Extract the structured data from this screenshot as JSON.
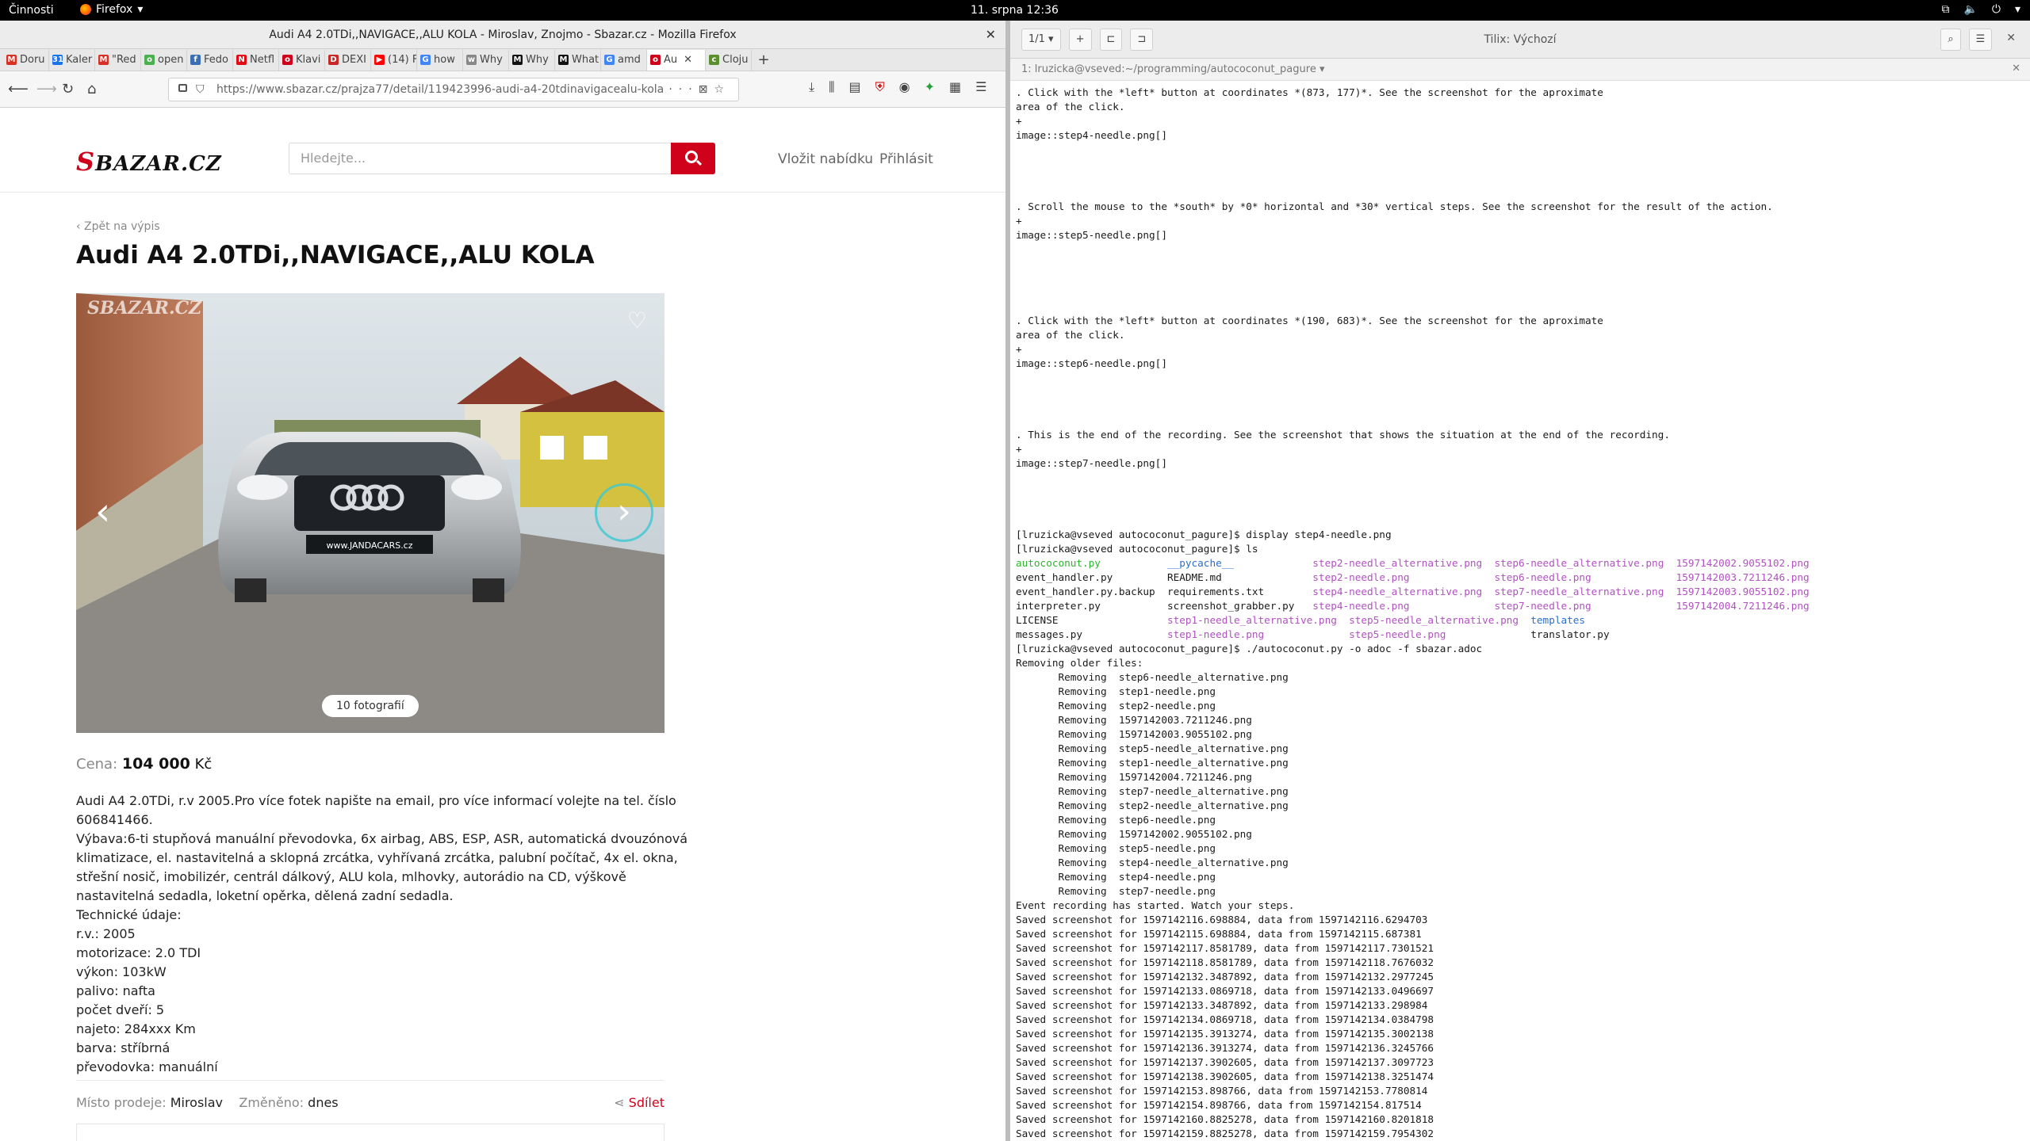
{
  "desktop": {
    "activities": "Činnosti",
    "app_name": "Firefox",
    "clock": "11. srpna  12:36"
  },
  "firefox": {
    "window_title": "Audi A4 2.0TDi,,NAVIGACE,,ALU KOLA - Miroslav, Znojmo - Sbazar.cz - Mozilla Firefox",
    "tabs": [
      {
        "label": "Doru",
        "color": "#d93025",
        "glyph": "M"
      },
      {
        "label": "Kaler",
        "color": "#1a73e8",
        "glyph": "31"
      },
      {
        "label": "\"Red",
        "color": "#d93025",
        "glyph": "M"
      },
      {
        "label": "open",
        "color": "#4caf50",
        "glyph": "o"
      },
      {
        "label": "Fedo",
        "color": "#3c6eb4",
        "glyph": "f"
      },
      {
        "label": "Netfl",
        "color": "#e50914",
        "glyph": "N"
      },
      {
        "label": "Klavi",
        "color": "#d0021b",
        "glyph": "o"
      },
      {
        "label": "DEXI",
        "color": "#c62828",
        "glyph": "D"
      },
      {
        "label": "(14) F",
        "color": "#ff0000",
        "glyph": "▶"
      },
      {
        "label": "how",
        "color": "#4285f4",
        "glyph": "G"
      },
      {
        "label": "Why",
        "color": "#888888",
        "glyph": "w"
      },
      {
        "label": "Why",
        "color": "#111111",
        "glyph": "M"
      },
      {
        "label": "What",
        "color": "#111111",
        "glyph": "M"
      },
      {
        "label": "amd",
        "color": "#4285f4",
        "glyph": "G"
      },
      {
        "label": "Au",
        "color": "#d0021b",
        "glyph": "o"
      },
      {
        "label": "Cloju",
        "color": "#5b8f2e",
        "glyph": "c"
      }
    ],
    "url": "https://www.sbazar.cz/prajza77/detail/119423996-audi-a4-20tdinavigacealu-kola"
  },
  "sbazar": {
    "logo": "SBAZAR.CZ",
    "search_placeholder": "Hledejte...",
    "offer_link": "Vložit nabídku",
    "login_link": "Přihlásit",
    "back_link": "‹ Zpět na výpis",
    "title": "Audi A4 2.0TDi,,NAVIGACE,,ALU KOLA",
    "watermark": "SBAZAR.CZ",
    "photo_count": "10 fotografií",
    "plate": "www.JANDACARS.cz",
    "price_label": "Cena:",
    "price_value": "104 000",
    "price_currency": "Kč",
    "description": [
      "Audi A4 2.0TDi, r.v 2005.Pro více fotek napište na email, pro více informací volejte na tel. číslo",
      "606841466.",
      "Výbava:6-ti stupňová manuální převodovka, 6x airbag, ABS, ESP, ASR, automatická dvouzónová",
      "klimatizace, el. nastavitelná a sklopná zrcátka, vyhřívaná zrcátka, palubní počítač, 4x el. okna,",
      "střešní nosič, imobilizér, centrál dálkový, ALU kola, mlhovky, autorádio na CD, výškově",
      "nastavitelná sedadla, loketní opěrka, dělená zadní sedadla.",
      "Technické údaje:",
      "r.v.: 2005",
      "motorizace: 2.0 TDI",
      "výkon: 103kW",
      "palivo: nafta",
      "počet dveří: 5",
      "najeto: 284xxx Km",
      "barva: stříbrná",
      "převodovka: manuální"
    ],
    "place_label": "Místo prodeje:",
    "place_value": "Miroslav",
    "changed_label": "Změněno:",
    "changed_value": "dnes",
    "share": "Sdílet"
  },
  "tilix": {
    "title": "Tilix: Výchozí",
    "session": "1/1",
    "tab_label": "1: lruzicka@vseved:~/programming/autococonut_pagure"
  },
  "terminal": [
    [
      [
        ". Click with the *left* button at coordinates *(873, 177)*. See the screenshot for the aproximate",
        ""
      ]
    ],
    [
      [
        "area of the click.",
        ""
      ]
    ],
    [
      [
        "+",
        ""
      ]
    ],
    [
      [
        "image::step4-needle.png[]",
        ""
      ]
    ],
    [],
    [],
    [],
    [],
    [
      [
        ". Scroll the mouse to the *south* by *0* horizontal and *30* vertical steps. See the screenshot for the result of the action.",
        ""
      ]
    ],
    [
      [
        "+",
        ""
      ]
    ],
    [
      [
        "image::step5-needle.png[]",
        ""
      ]
    ],
    [],
    [],
    [],
    [],
    [],
    [
      [
        ". Click with the *left* button at coordinates *(190, 683)*. See the screenshot for the aproximate",
        ""
      ]
    ],
    [
      [
        "area of the click.",
        ""
      ]
    ],
    [
      [
        "+",
        ""
      ]
    ],
    [
      [
        "image::step6-needle.png[]",
        ""
      ]
    ],
    [],
    [],
    [],
    [],
    [
      [
        ". This is the end of the recording. See the screenshot that shows the situation at the end of the recording.",
        ""
      ]
    ],
    [
      [
        "+",
        ""
      ]
    ],
    [
      [
        "image::step7-needle.png[]",
        ""
      ]
    ],
    [],
    [],
    [],
    [],
    [
      [
        "[lruzicka@vseved autococonut_pagure]$ display step4-needle.png",
        ""
      ]
    ],
    [
      [
        "[lruzicka@vseved autococonut_pagure]$ ls",
        ""
      ]
    ],
    [
      [
        "autococonut.py           ",
        "c-green"
      ],
      [
        "__pycache__             ",
        "c-blue"
      ],
      [
        "step2-needle_alternative.png  ",
        "c-mag"
      ],
      [
        "step6-needle_alternative.png  ",
        "c-mag"
      ],
      [
        "1597142002.9055102.png",
        "c-mag"
      ]
    ],
    [
      [
        "event_handler.py         ",
        ""
      ],
      [
        "README.md               ",
        ""
      ],
      [
        "step2-needle.png              ",
        "c-mag"
      ],
      [
        "step6-needle.png              ",
        "c-mag"
      ],
      [
        "1597142003.7211246.png",
        "c-mag"
      ]
    ],
    [
      [
        "event_handler.py.backup  ",
        ""
      ],
      [
        "requirements.txt        ",
        ""
      ],
      [
        "step4-needle_alternative.png  ",
        "c-mag"
      ],
      [
        "step7-needle_alternative.png  ",
        "c-mag"
      ],
      [
        "1597142003.9055102.png",
        "c-mag"
      ]
    ],
    [
      [
        "interpreter.py           ",
        ""
      ],
      [
        "screenshot_grabber.py   ",
        ""
      ],
      [
        "step4-needle.png              ",
        "c-mag"
      ],
      [
        "step7-needle.png              ",
        "c-mag"
      ],
      [
        "1597142004.7211246.png",
        "c-mag"
      ]
    ],
    [
      [
        "LICENSE                  ",
        ""
      ],
      [
        "step1-needle_alternative.png  ",
        "c-mag"
      ],
      [
        "step5-needle_alternative.png  ",
        "c-mag"
      ],
      [
        "templates",
        "c-blue"
      ]
    ],
    [
      [
        "messages.py              ",
        ""
      ],
      [
        "step1-needle.png              ",
        "c-mag"
      ],
      [
        "step5-needle.png              ",
        "c-mag"
      ],
      [
        "translator.py",
        ""
      ]
    ],
    [
      [
        "[lruzicka@vseved autococonut_pagure]$ ./autococonut.py -o adoc -f sbazar.adoc",
        ""
      ]
    ],
    [
      [
        "Removing older files:",
        ""
      ]
    ],
    [
      [
        "       Removing  step6-needle_alternative.png",
        ""
      ]
    ],
    [
      [
        "       Removing  step1-needle.png",
        ""
      ]
    ],
    [
      [
        "       Removing  step2-needle.png",
        ""
      ]
    ],
    [
      [
        "       Removing  1597142003.7211246.png",
        ""
      ]
    ],
    [
      [
        "       Removing  1597142003.9055102.png",
        ""
      ]
    ],
    [
      [
        "       Removing  step5-needle_alternative.png",
        ""
      ]
    ],
    [
      [
        "       Removing  step1-needle_alternative.png",
        ""
      ]
    ],
    [
      [
        "       Removing  1597142004.7211246.png",
        ""
      ]
    ],
    [
      [
        "       Removing  step7-needle_alternative.png",
        ""
      ]
    ],
    [
      [
        "       Removing  step2-needle_alternative.png",
        ""
      ]
    ],
    [
      [
        "       Removing  step6-needle.png",
        ""
      ]
    ],
    [
      [
        "       Removing  1597142002.9055102.png",
        ""
      ]
    ],
    [
      [
        "       Removing  step5-needle.png",
        ""
      ]
    ],
    [
      [
        "       Removing  step4-needle_alternative.png",
        ""
      ]
    ],
    [
      [
        "       Removing  step4-needle.png",
        ""
      ]
    ],
    [
      [
        "       Removing  step7-needle.png",
        ""
      ]
    ],
    [
      [
        "Event recording has started. Watch your steps.",
        ""
      ]
    ],
    [
      [
        "Saved screenshot for 1597142116.698884, data from 1597142116.6294703",
        ""
      ]
    ],
    [
      [
        "Saved screenshot for 1597142115.698884, data from 1597142115.687381",
        ""
      ]
    ],
    [
      [
        "Saved screenshot for 1597142117.8581789, data from 1597142117.7301521",
        ""
      ]
    ],
    [
      [
        "Saved screenshot for 1597142118.8581789, data from 1597142118.7676032",
        ""
      ]
    ],
    [
      [
        "Saved screenshot for 1597142132.3487892, data from 1597142132.2977245",
        ""
      ]
    ],
    [
      [
        "Saved screenshot for 1597142133.0869718, data from 1597142133.0496697",
        ""
      ]
    ],
    [
      [
        "Saved screenshot for 1597142133.3487892, data from 1597142133.298984",
        ""
      ]
    ],
    [
      [
        "Saved screenshot for 1597142134.0869718, data from 1597142134.0384798",
        ""
      ]
    ],
    [
      [
        "Saved screenshot for 1597142135.3913274, data from 1597142135.3002138",
        ""
      ]
    ],
    [
      [
        "Saved screenshot for 1597142136.3913274, data from 1597142136.3245766",
        ""
      ]
    ],
    [
      [
        "Saved screenshot for 1597142137.3902605, data from 1597142137.3097723",
        ""
      ]
    ],
    [
      [
        "Saved screenshot for 1597142138.3902605, data from 1597142138.3251474",
        ""
      ]
    ],
    [
      [
        "Saved screenshot for 1597142153.898766, data from 1597142153.7780814",
        ""
      ]
    ],
    [
      [
        "Saved screenshot for 1597142154.898766, data from 1597142154.817514",
        ""
      ]
    ],
    [
      [
        "Saved screenshot for 1597142160.8825278, data from 1597142160.8201818",
        ""
      ]
    ],
    [
      [
        "Saved screenshot for 1597142159.8825278, data from 1597142159.7954302",
        ""
      ]
    ]
  ]
}
